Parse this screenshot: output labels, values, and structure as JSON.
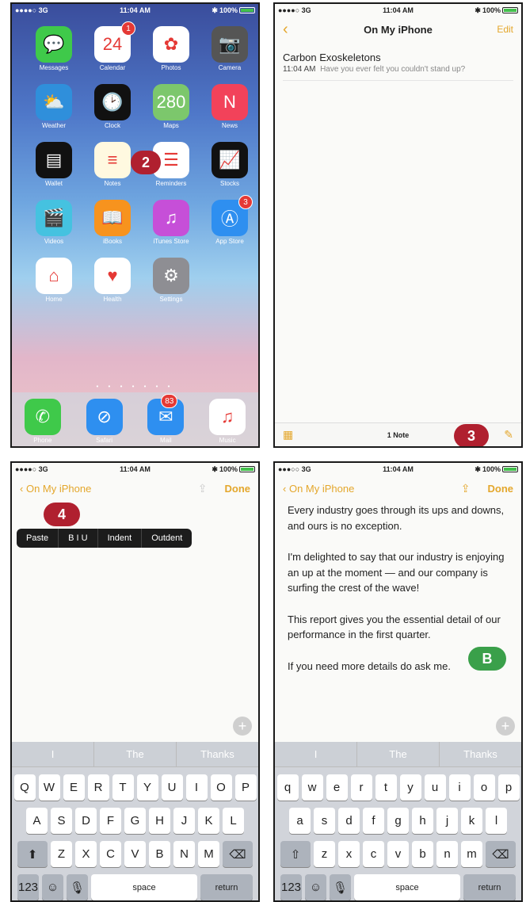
{
  "status": {
    "carrier": "●●●●○ 3G",
    "carrier2": "●●●○○ 3G",
    "time": "11:04 AM",
    "battery": "100%"
  },
  "home": {
    "apps": [
      {
        "label": "Messages",
        "icon": "messages-icon",
        "color": "#3fc94a",
        "glyph": "💬"
      },
      {
        "label": "Calendar",
        "icon": "calendar-icon",
        "color": "#ffffff",
        "glyph": "24",
        "badge": "1",
        "day": "Friday"
      },
      {
        "label": "Photos",
        "icon": "photos-icon",
        "color": "#ffffff",
        "glyph": "✿"
      },
      {
        "label": "Camera",
        "icon": "camera-icon",
        "color": "#555555",
        "glyph": "📷"
      },
      {
        "label": "Weather",
        "icon": "weather-icon",
        "color": "#2f8fdb",
        "glyph": "⛅"
      },
      {
        "label": "Clock",
        "icon": "clock-icon",
        "color": "#111111",
        "glyph": "🕑"
      },
      {
        "label": "Maps",
        "icon": "maps-icon",
        "color": "#7cc76c",
        "glyph": "280"
      },
      {
        "label": "News",
        "icon": "news-icon",
        "color": "#f2425a",
        "glyph": "N"
      },
      {
        "label": "Wallet",
        "icon": "wallet-icon",
        "color": "#111111",
        "glyph": "▤"
      },
      {
        "label": "Notes",
        "icon": "notes-icon",
        "color": "#fff9e0",
        "glyph": "≡"
      },
      {
        "label": "Reminders",
        "icon": "reminders-icon",
        "color": "#ffffff",
        "glyph": "☰"
      },
      {
        "label": "Stocks",
        "icon": "stocks-icon",
        "color": "#111111",
        "glyph": "📈"
      },
      {
        "label": "Videos",
        "icon": "videos-icon",
        "color": "#45c2e0",
        "glyph": "🎬"
      },
      {
        "label": "iBooks",
        "icon": "ibooks-icon",
        "color": "#f7931e",
        "glyph": "📖"
      },
      {
        "label": "iTunes Store",
        "icon": "itunes-icon",
        "color": "#c64fd8",
        "glyph": "♫"
      },
      {
        "label": "App Store",
        "icon": "appstore-icon",
        "color": "#2e8ff0",
        "glyph": "Ⓐ",
        "badge": "3"
      },
      {
        "label": "Home",
        "icon": "home-icon",
        "color": "#ffffff",
        "glyph": "⌂"
      },
      {
        "label": "Health",
        "icon": "health-icon",
        "color": "#ffffff",
        "glyph": "♥"
      },
      {
        "label": "Settings",
        "icon": "settings-icon",
        "color": "#8e8e93",
        "glyph": "⚙"
      }
    ],
    "page_dots": "• • • • • • •",
    "dock": [
      {
        "label": "Phone",
        "icon": "phone-icon",
        "color": "#3fc94a",
        "glyph": "✆"
      },
      {
        "label": "Safari",
        "icon": "safari-icon",
        "color": "#2e8ff0",
        "glyph": "⊘"
      },
      {
        "label": "Mail",
        "icon": "mail-icon",
        "color": "#2e8ff0",
        "glyph": "✉",
        "badge": "83"
      },
      {
        "label": "Music",
        "icon": "music-icon",
        "color": "#ffffff",
        "glyph": "♫"
      }
    ]
  },
  "callouts": {
    "c2": "2",
    "c3": "3",
    "c4": "4",
    "cB": "B"
  },
  "notes_list": {
    "title": "On My iPhone",
    "edit": "Edit",
    "note_title": "Carbon Exoskeletons",
    "note_time": "11:04 AM",
    "note_preview": "Have you ever felt you couldn't stand up?",
    "count": "1 Note"
  },
  "editor": {
    "back": "On My iPhone",
    "done": "Done",
    "menu": [
      "Paste",
      "B I U",
      "Indent",
      "Outdent"
    ],
    "paragraphs": [
      "Every industry goes through its ups and downs, and ours is no exception.",
      "I'm delighted to say that our industry is enjoying an up at the moment — and our company is surfing the crest of the wave!",
      "This report gives you the essential detail of our performance in the first quarter.",
      "If you need more details do ask me."
    ]
  },
  "keyboard": {
    "suggestions": [
      "I",
      "The",
      "Thanks"
    ],
    "row1_upper": [
      "Q",
      "W",
      "E",
      "R",
      "T",
      "Y",
      "U",
      "I",
      "O",
      "P"
    ],
    "row2_upper": [
      "A",
      "S",
      "D",
      "F",
      "G",
      "H",
      "J",
      "K",
      "L"
    ],
    "row3_upper": [
      "Z",
      "X",
      "C",
      "V",
      "B",
      "N",
      "M"
    ],
    "row1_lower": [
      "q",
      "w",
      "e",
      "r",
      "t",
      "y",
      "u",
      "i",
      "o",
      "p"
    ],
    "row2_lower": [
      "a",
      "s",
      "d",
      "f",
      "g",
      "h",
      "j",
      "k",
      "l"
    ],
    "row3_lower": [
      "z",
      "x",
      "c",
      "v",
      "b",
      "n",
      "m"
    ],
    "num": "123",
    "space": "space",
    "ret": "return",
    "shift": "⬆",
    "shift_outline": "⇧",
    "delete": "⌫",
    "emoji": "☺",
    "mic": "🎙"
  }
}
